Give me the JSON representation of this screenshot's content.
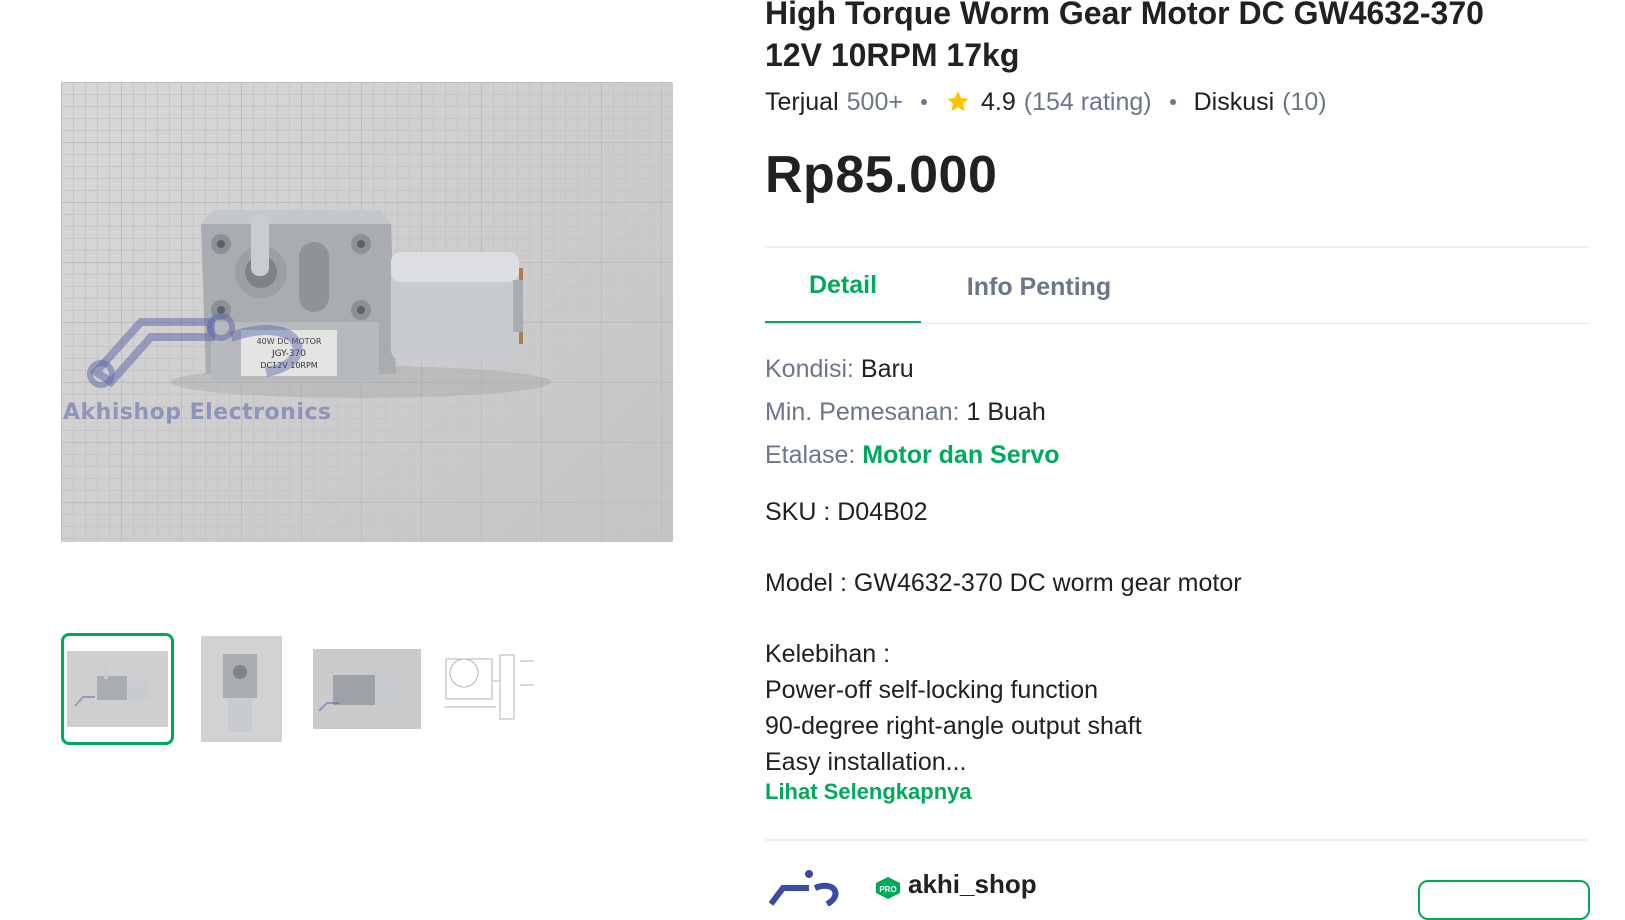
{
  "gallery": {
    "watermark": "Akhishop Electronics",
    "thumbnails": [
      {
        "name": "thumbnail-1",
        "active": true
      },
      {
        "name": "thumbnail-2",
        "active": false
      },
      {
        "name": "thumbnail-3",
        "active": false
      },
      {
        "name": "thumbnail-4",
        "active": false
      }
    ]
  },
  "product": {
    "title_line1": "High Torque Worm Gear Motor DC GW4632-370",
    "title_line2": "12V 10RPM 17kg",
    "sold_label": "Terjual",
    "sold_count": "500+",
    "rating": "4.9",
    "rating_count": "(154 rating)",
    "discussion_label": "Diskusi",
    "discussion_count": "(10)",
    "price": "Rp85.000"
  },
  "tabs": [
    {
      "label": "Detail",
      "active": true
    },
    {
      "label": "Info Penting",
      "active": false
    }
  ],
  "specs": {
    "condition_label": "Kondisi:",
    "condition_value": "Baru",
    "min_order_label": "Min. Pemesanan:",
    "min_order_value": "1 Buah",
    "showcase_label": "Etalase:",
    "showcase_value": "Motor dan Servo"
  },
  "description": {
    "sku": "SKU : D04B02",
    "model": "Model : GW4632-370 DC worm gear motor",
    "advantages_heading": "Kelebihan :",
    "advantage_1": "Power-off self-locking function",
    "advantage_2": "90-degree right-angle output shaft",
    "advantage_3": "Easy installation...",
    "see_more": "Lihat Selengkapnya"
  },
  "shop": {
    "name": "akhi_shop",
    "badge": "PRO"
  },
  "colors": {
    "brand_green": "#00aa5b",
    "muted_text": "#6d7588",
    "star": "#ffc400"
  }
}
